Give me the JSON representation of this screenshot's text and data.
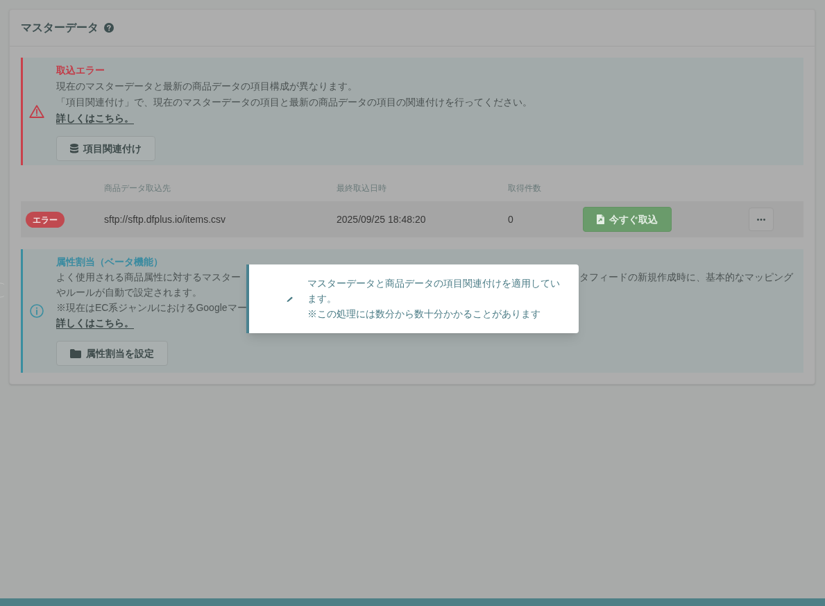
{
  "panel": {
    "title": "マスターデータ",
    "blocks": [
      {
        "kind": "error_alert",
        "title": "取込エラー",
        "lines": [
          [
            "現在のマスターデータと最新の商品データの項目構成が異なります。"
          ],
          [
            "「項目関連付け」で、現在のマスターデータの項目と最新の商品データの項目の関連付けを行ってください。"
          ]
        ],
        "link": "詳しくはこちら。",
        "button": "項目関連付け"
      },
      {
        "kind": "table",
        "columns": [
          "商品データ取込先",
          "最終取込日時",
          "取得件数"
        ],
        "rows": [
          {
            "status": {
              "label": "エラー",
              "kind": "error"
            },
            "source": "sftp://sftp.dfplus.io/items.csv",
            "last_import": "2025/09/25 18:48:20",
            "count": "0",
            "action": "今すぐ取込"
          }
        ]
      },
      {
        "kind": "info_alert",
        "title": "属性割当（ベータ機能）",
        "lines": [
          [
            "よく使用される商品属性に対するマスター",
            "タフィードの新規作成時に、基本的なマッピング"
          ],
          [
            "やルールが自動で設定されます。"
          ],
          [
            "※現在はEC系ジャンルにおけるGoogleマー"
          ]
        ],
        "link": "詳しくはこちら。",
        "button": "属性割当を設定"
      }
    ]
  },
  "toast": {
    "message": "マスターデータと商品データの項目関連付けを適用しています。",
    "note": "※この処理には数分から数十分かかることがあります"
  }
}
